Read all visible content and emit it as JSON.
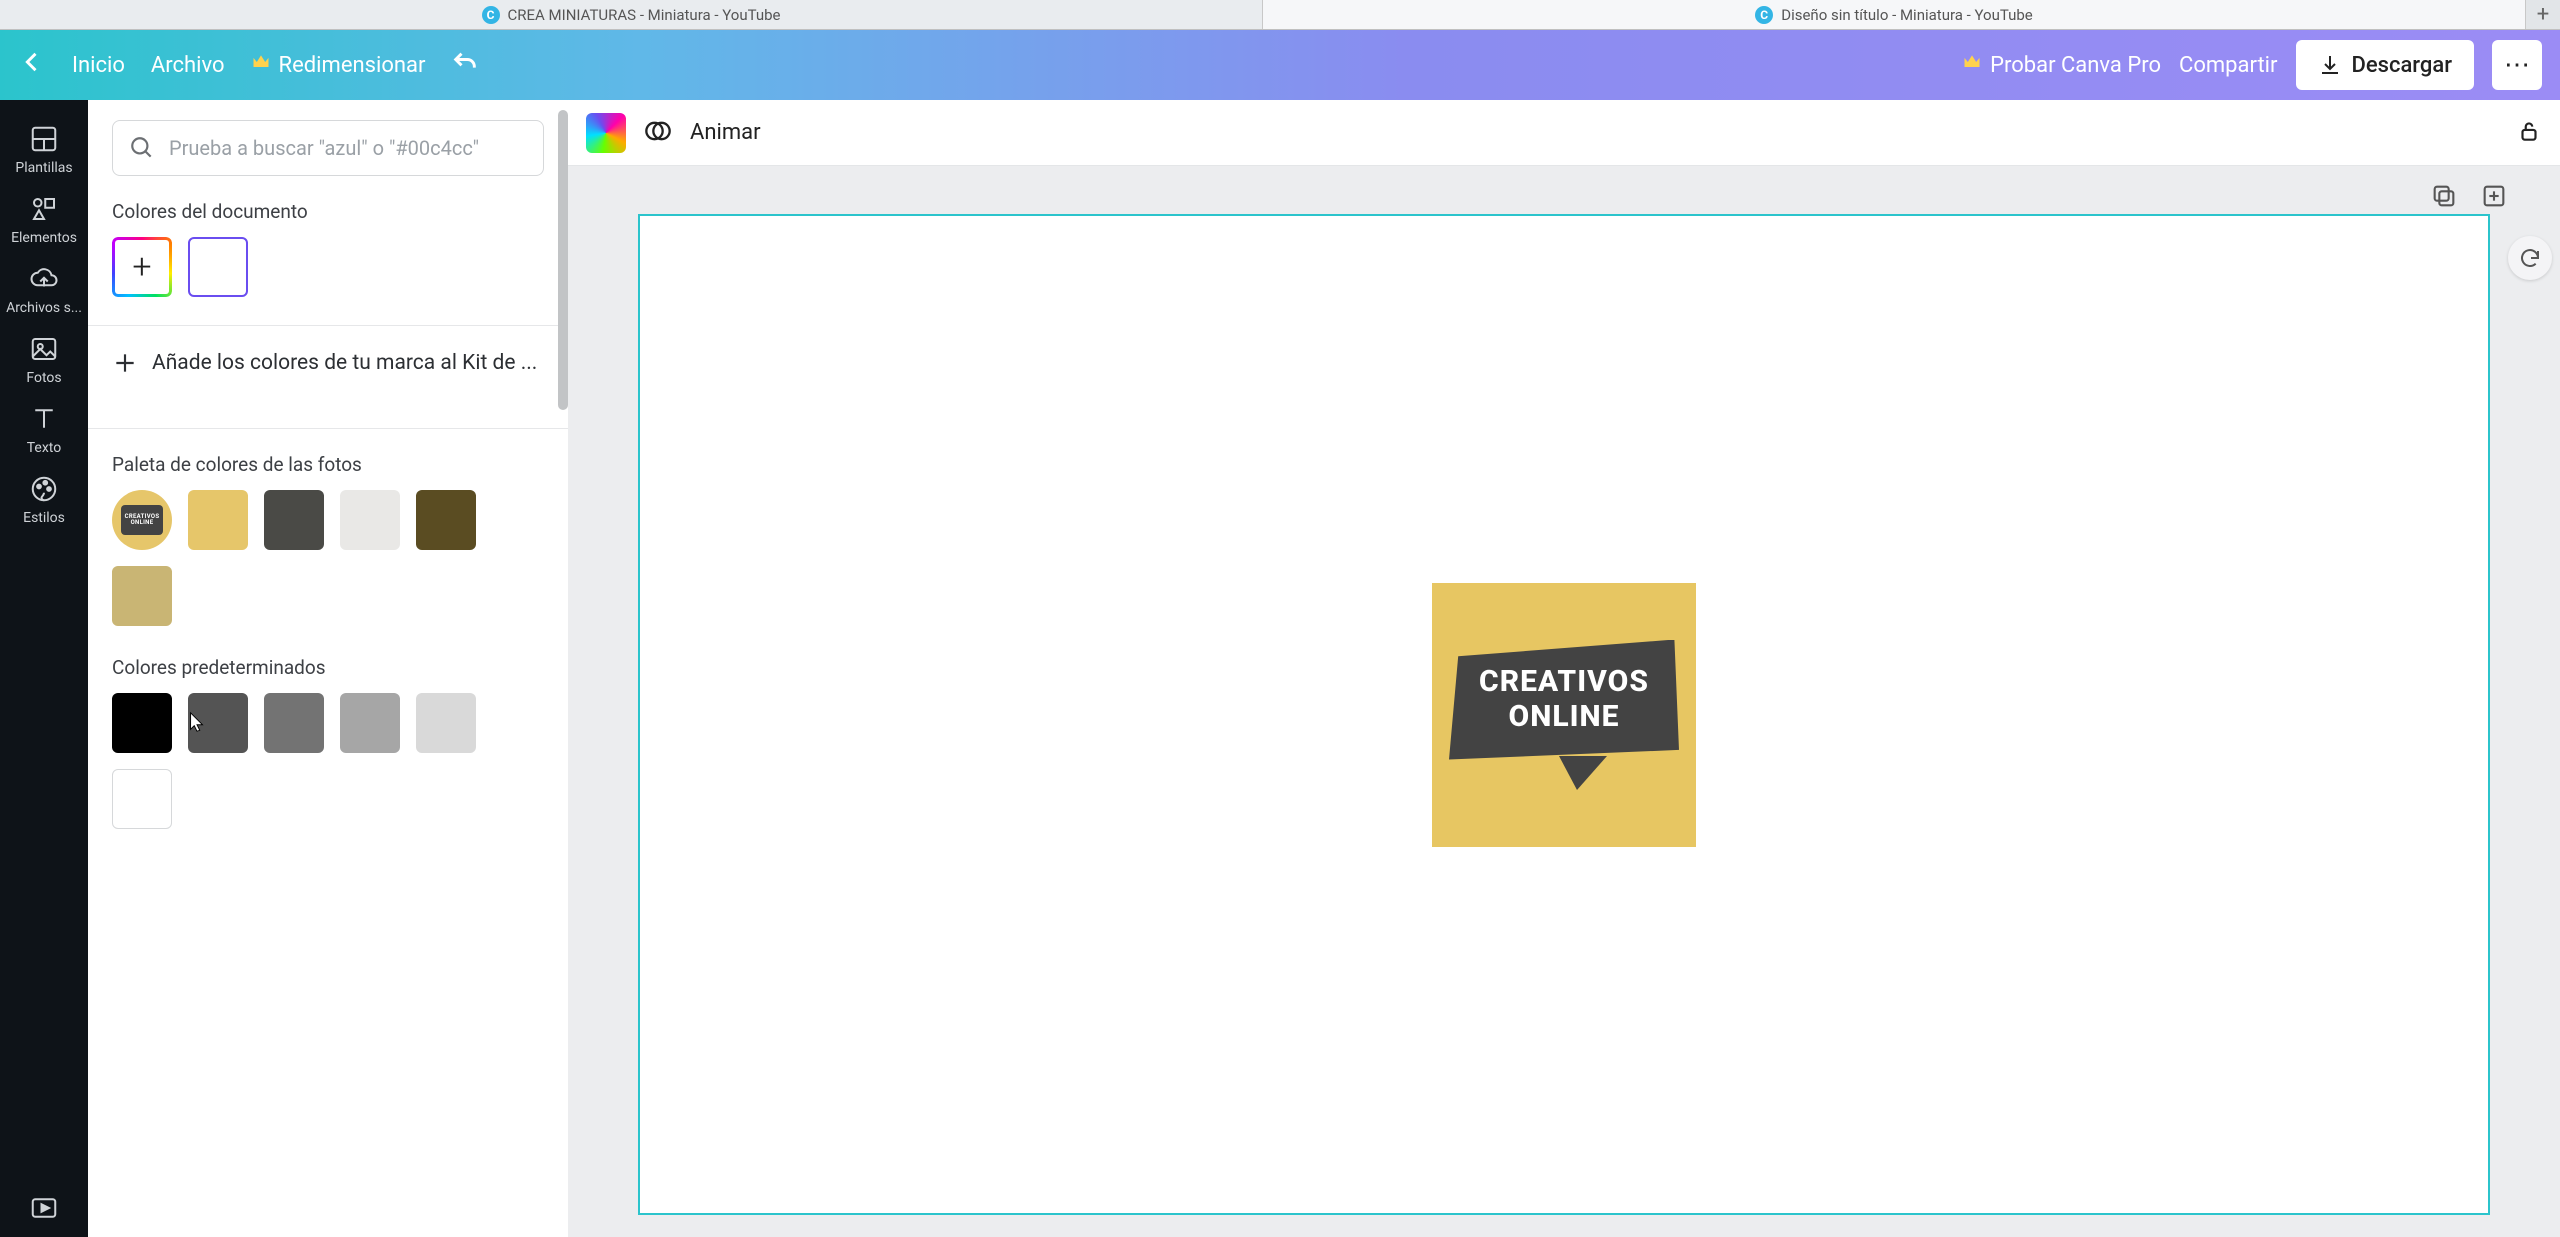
{
  "tabs": {
    "items": [
      {
        "title": "CREA MINIATURAS - Miniatura - YouTube"
      },
      {
        "title": "Diseño sin título - Miniatura - YouTube"
      }
    ]
  },
  "appbar": {
    "home": "Inicio",
    "file": "Archivo",
    "resize": "Redimensionar",
    "try_pro": "Probar Canva Pro",
    "share": "Compartir",
    "download": "Descargar"
  },
  "rail": {
    "templates": "Plantillas",
    "elements": "Elementos",
    "uploads": "Archivos s...",
    "photos": "Fotos",
    "text": "Texto",
    "styles": "Estilos"
  },
  "panel": {
    "search_placeholder": "Prueba a buscar \"azul\" o \"#00c4cc\"",
    "doc_colors_title": "Colores del documento",
    "brand_kit_label": "Añade los colores de tu marca al Kit de ...",
    "photo_palette_title": "Paleta de colores de las fotos",
    "default_colors_title": "Colores predeterminados",
    "photo_palette": [
      "#e6c66a",
      "#4a4a46",
      "#e9e8e6",
      "#5a4c22",
      "#c9b574"
    ],
    "default_colors": [
      "#000000",
      "#545454",
      "#737373",
      "#a6a6a6",
      "#d9d9d9",
      "#ffffff"
    ]
  },
  "canvas_bar": {
    "animate": "Animar"
  },
  "artwork": {
    "line1": "CREATIVOS",
    "line2": "ONLINE",
    "bg_color": "#e7c662",
    "bubble_color": "#434343"
  }
}
